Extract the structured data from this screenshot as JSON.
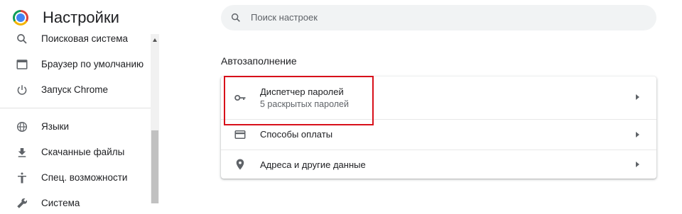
{
  "header": {
    "title": "Настройки",
    "logo_icon": "chrome-logo-icon"
  },
  "search": {
    "icon": "search-icon",
    "placeholder": "Поиск настроек"
  },
  "sidebar": {
    "items": [
      {
        "icon": "search-icon",
        "label": "Поисковая система"
      },
      {
        "icon": "browser-window-icon",
        "label": "Браузер по умолчанию"
      },
      {
        "icon": "power-icon",
        "label": "Запуск Chrome"
      },
      {
        "icon": "globe-icon",
        "label": "Языки"
      },
      {
        "icon": "download-icon",
        "label": "Скачанные файлы"
      },
      {
        "icon": "accessibility-icon",
        "label": "Спец. возможности"
      },
      {
        "icon": "wrench-icon",
        "label": "Система"
      }
    ]
  },
  "autofill": {
    "section_title": "Автозаполнение",
    "rows": [
      {
        "icon": "key-icon",
        "title": "Диспетчер паролей",
        "subtitle": "5 раскрытых паролей"
      },
      {
        "icon": "credit-card-icon",
        "title": "Способы оплаты"
      },
      {
        "icon": "location-pin-icon",
        "title": "Адреса и другие данные"
      }
    ]
  },
  "colors": {
    "highlight_border": "#d8101a",
    "search_background": "#f1f3f4",
    "icon_color": "#5f6368"
  }
}
